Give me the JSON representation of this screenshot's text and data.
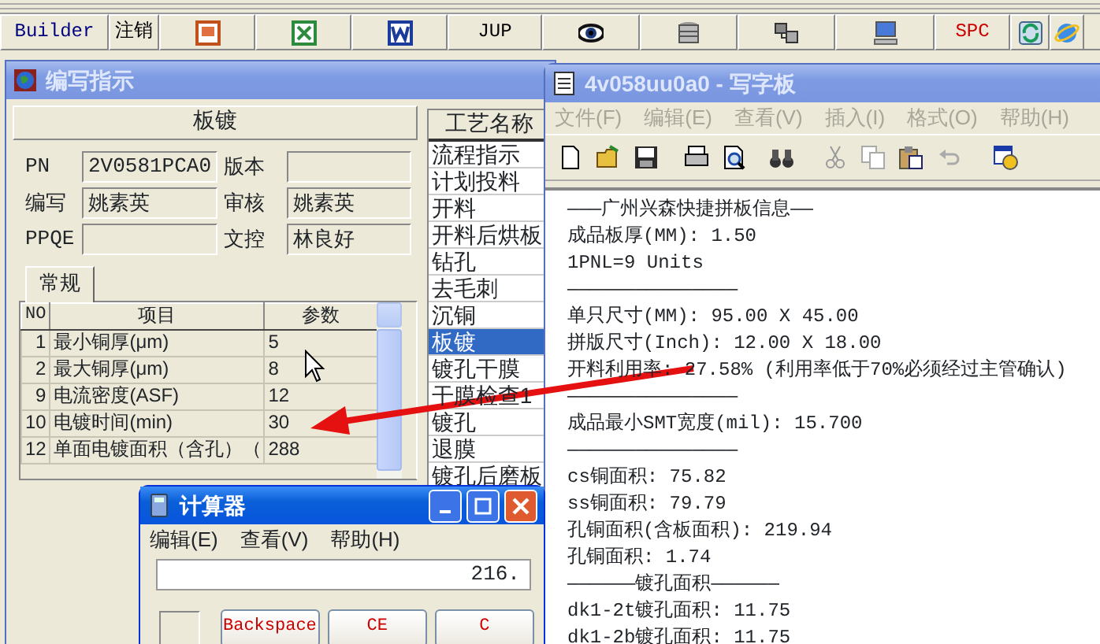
{
  "toolbar": [
    {
      "kind": "text",
      "label": "Builder"
    },
    {
      "kind": "text",
      "label": "注销"
    },
    {
      "kind": "icon"
    },
    {
      "kind": "icon"
    },
    {
      "kind": "icon"
    },
    {
      "kind": "text",
      "label": "JUP"
    },
    {
      "kind": "icon"
    },
    {
      "kind": "icon"
    },
    {
      "kind": "icon"
    },
    {
      "kind": "icon"
    },
    {
      "kind": "text",
      "label": "SPC"
    },
    {
      "kind": "icon"
    },
    {
      "kind": "icon"
    }
  ],
  "instruction_window": {
    "title": "编写指示",
    "active": false,
    "header": "板镀",
    "fields": [
      {
        "label": "PN",
        "value": "2V0581PCA0"
      },
      {
        "label": "版本"
      },
      {
        "label": "编写",
        "value": "姚素英"
      },
      {
        "label": "审核",
        "value": "姚素英"
      },
      {
        "label": "PPQE"
      },
      {
        "label": "文控",
        "value": "林良好"
      }
    ],
    "tabs": [
      {
        "label": "常规",
        "selected": true
      }
    ],
    "table": {
      "columns": [
        "NO",
        "项目",
        "参数"
      ],
      "rows": [
        [
          "1",
          "最小铜厚(μm)",
          "5"
        ],
        [
          "2",
          "最大铜厚(μm)",
          "8"
        ],
        [
          "9",
          "电流密度(ASF)",
          "12"
        ],
        [
          "10",
          "电镀时间(min)",
          "30"
        ],
        [
          "12",
          "单面电镀面积（含孔）（",
          "288"
        ]
      ]
    },
    "process_list": {
      "heading": "工艺名称",
      "items": [
        {
          "label": "流程指示",
          "selected": false
        },
        {
          "label": "计划投料",
          "selected": false
        },
        {
          "label": "开料",
          "selected": false
        },
        {
          "label": "开料后烘板",
          "selected": false
        },
        {
          "label": "钻孔",
          "selected": false
        },
        {
          "label": "去毛刺",
          "selected": false
        },
        {
          "label": "沉铜",
          "selected": false
        },
        {
          "label": "板镀",
          "selected": true
        },
        {
          "label": "镀孔干膜",
          "selected": false
        },
        {
          "label": "干膜检查1",
          "selected": false
        },
        {
          "label": "镀孔",
          "selected": false
        },
        {
          "label": "退膜",
          "selected": false
        },
        {
          "label": "镀孔后磨板",
          "selected": false
        }
      ]
    }
  },
  "wordpad": {
    "title": "4v058uu0a0 - 写字板",
    "active": false,
    "menu": [
      "文件(F)",
      "编辑(E)",
      "查看(V)",
      "插入(I)",
      "格式(O)",
      "帮助(H)"
    ],
    "lines": [
      "———广州兴森快捷拼板信息——",
      "成品板厚(MM): 1.50",
      "1PNL=9 Units",
      "———————————————",
      "单只尺寸(MM): 95.00 X 45.00",
      "拼版尺寸(Inch): 12.00 X 18.00",
      "开料利用率: 27.58% (利用率低于70%必须经过主管确认)",
      "———————————————",
      "成品最小SMT宽度(mil): 15.700",
      "———————————————",
      "cs铜面积: 75.82",
      "ss铜面积: 79.79",
      "孔铜面积(含板面积): 219.94",
      "孔铜面积: 1.74",
      "——————镀孔面积——————",
      "dk1-2t镀孔面积: 11.75",
      "dk1-2b镀孔面积: 11.75"
    ]
  },
  "calculator": {
    "title": "计算器",
    "active": true,
    "menu": [
      "编辑(E)",
      "查看(V)",
      "帮助(H)"
    ],
    "display": "216.",
    "buttons": [
      "Backspace",
      "CE",
      "C"
    ]
  }
}
